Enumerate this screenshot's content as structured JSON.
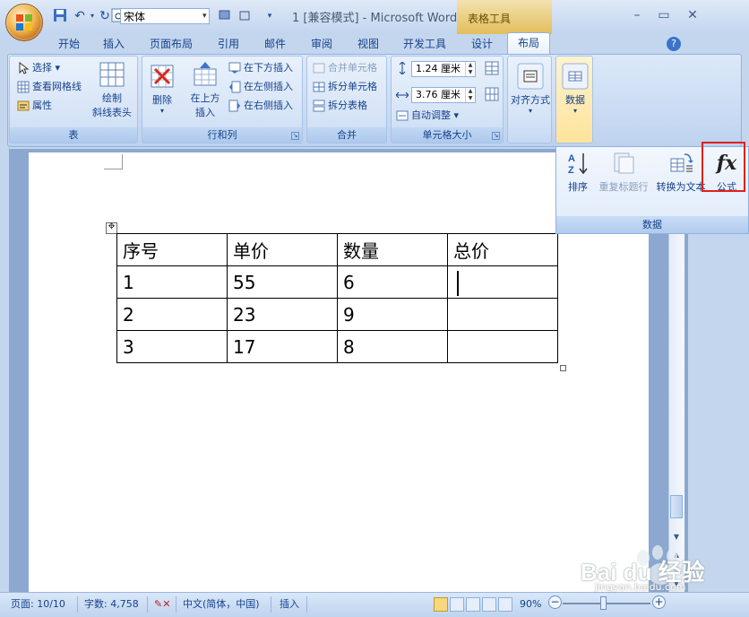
{
  "window": {
    "title": "1 [兼容模式] - Microsoft Word",
    "context_tab_group": "表格工具",
    "font_name": "宋体"
  },
  "tabs": [
    {
      "label": "开始"
    },
    {
      "label": "插入"
    },
    {
      "label": "页面布局"
    },
    {
      "label": "引用"
    },
    {
      "label": "邮件"
    },
    {
      "label": "审阅"
    },
    {
      "label": "视图"
    },
    {
      "label": "开发工具"
    },
    {
      "label": "设计"
    },
    {
      "label": "布局"
    }
  ],
  "ribbon": {
    "table_group": {
      "label": "表",
      "select": "选择",
      "view_gridlines": "查看网格线",
      "properties": "属性",
      "draw_diagonal_line1": "绘制",
      "draw_diagonal_line2": "斜线表头"
    },
    "rows_cols_group": {
      "label": "行和列",
      "delete": "删除",
      "insert_above1": "在上方",
      "insert_above2": "插入",
      "insert_below": "在下方插入",
      "insert_left": "在左侧插入",
      "insert_right": "在右侧插入"
    },
    "merge_group": {
      "label": "合并",
      "merge_cells": "合并单元格",
      "split_cells": "拆分单元格",
      "split_table": "拆分表格"
    },
    "cell_size_group": {
      "label": "单元格大小",
      "height_value": "1.24 厘米",
      "width_value": "3.76 厘米",
      "autofit": "自动调整"
    },
    "alignment": "对齐方式",
    "data": "数据"
  },
  "data_panel": {
    "label": "数据",
    "sort": "排序",
    "repeat_header_rows": "重复标题行",
    "convert_to_text": "转换为文本",
    "formula": "公式",
    "formula_icon_text": "fx"
  },
  "table": {
    "rows": [
      [
        "序号",
        "单价",
        "数量",
        "总价"
      ],
      [
        "1",
        "55",
        "6",
        ""
      ],
      [
        "2",
        "23",
        "9",
        ""
      ],
      [
        "3",
        "17",
        "8",
        ""
      ]
    ]
  },
  "statusbar": {
    "page": "页面: 10/10",
    "word_count": "字数: 4,758",
    "language": "中文(简体，中国)",
    "insert_mode": "插入",
    "zoom": "90%"
  },
  "watermark": {
    "text": "Bai du 经验",
    "url": "jingyan.baidu.com"
  },
  "colors": {
    "highlight": "#e0201c",
    "context_tab": "#e9cc7c"
  }
}
